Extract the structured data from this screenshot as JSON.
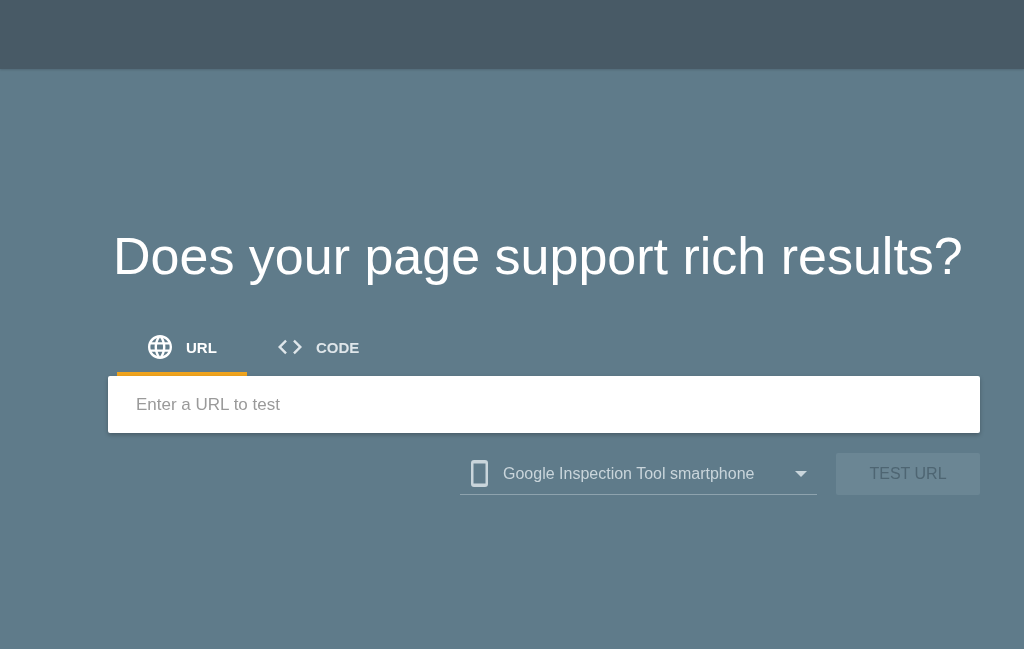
{
  "heading": "Does your page support rich results?",
  "tabs": [
    {
      "label": "URL",
      "selected": true
    },
    {
      "label": "CODE",
      "selected": false
    }
  ],
  "url_field": {
    "placeholder": "Enter a URL to test"
  },
  "user_agent_select": {
    "value": "Google Inspection Tool smartphone"
  },
  "test_button": {
    "label": "TEST URL",
    "disabled": true
  }
}
